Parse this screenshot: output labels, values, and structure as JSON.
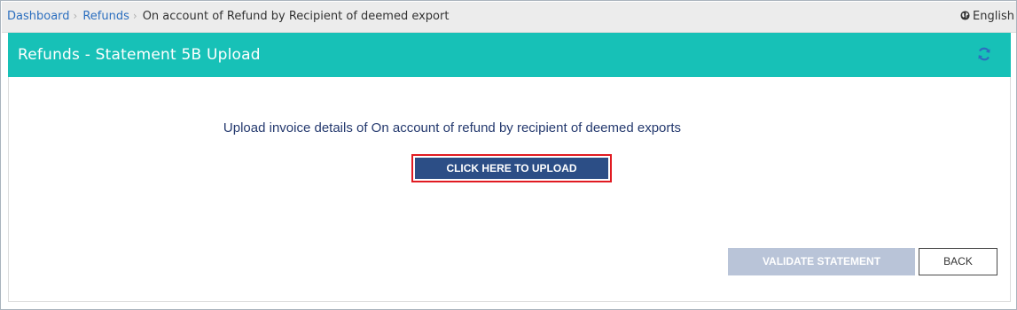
{
  "breadcrumb": {
    "items": [
      {
        "label": "Dashboard"
      },
      {
        "label": "Refunds"
      },
      {
        "label": "On account of Refund by Recipient of deemed export"
      }
    ]
  },
  "language": {
    "label": "English",
    "icon": "globe-icon"
  },
  "header": {
    "title": "Refunds - Statement 5B Upload",
    "background_color": "#17c1b7",
    "refresh_icon": "refresh-icon"
  },
  "main": {
    "instruction": "Upload invoice details of On account of refund by recipient of deemed exports",
    "upload_button": "CLICK HERE TO UPLOAD",
    "upload_button_color": "#2c4e86",
    "highlight_color": "#e11b22",
    "validate_button": "VALIDATE STATEMENT",
    "validate_button_color": "#b9c4d8",
    "back_button": "BACK"
  }
}
